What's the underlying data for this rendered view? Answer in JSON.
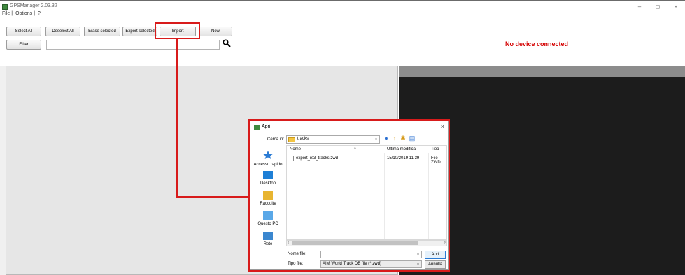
{
  "window": {
    "title": "GPSManager 2.03.32",
    "menu": [
      "File",
      "Options",
      "?"
    ],
    "controls": [
      "–",
      "◻",
      "×"
    ]
  },
  "toolbar": {
    "select_all": "Select All",
    "deselect_all": "Deselect All",
    "erase_selected": "Erase selected",
    "export_selected": "Export selected",
    "import": "Import",
    "new": "New",
    "filter": "Filter"
  },
  "filter": {
    "value": "",
    "search_icon": "search-icon"
  },
  "status": {
    "message": "No device connected",
    "color": "#d40000"
  },
  "dialog": {
    "title": "Apri",
    "close": "×",
    "lookin_label": "Cerca in:",
    "lookin_value": "tracks",
    "places": [
      "Accesso rapido",
      "Desktop",
      "Raccolte",
      "Questo PC",
      "Rete"
    ],
    "columns": [
      "Nome",
      "Ultima modifica",
      "Tipo"
    ],
    "sort_indicator": "^",
    "files": [
      {
        "name": "export_rs3_tracks.zwd",
        "modified": "15/10/2019 11:39",
        "type": "File ZWD"
      }
    ],
    "filename_label": "Nome file:",
    "filename_value": "",
    "filetype_label": "Tipo file:",
    "filetype_value": "AIM World Track DB file (*.zwd)",
    "open_button": "Apri",
    "cancel_button": "Annulla"
  },
  "colors": {
    "highlight": "#d81b1b",
    "accent": "#3f8a3f"
  }
}
